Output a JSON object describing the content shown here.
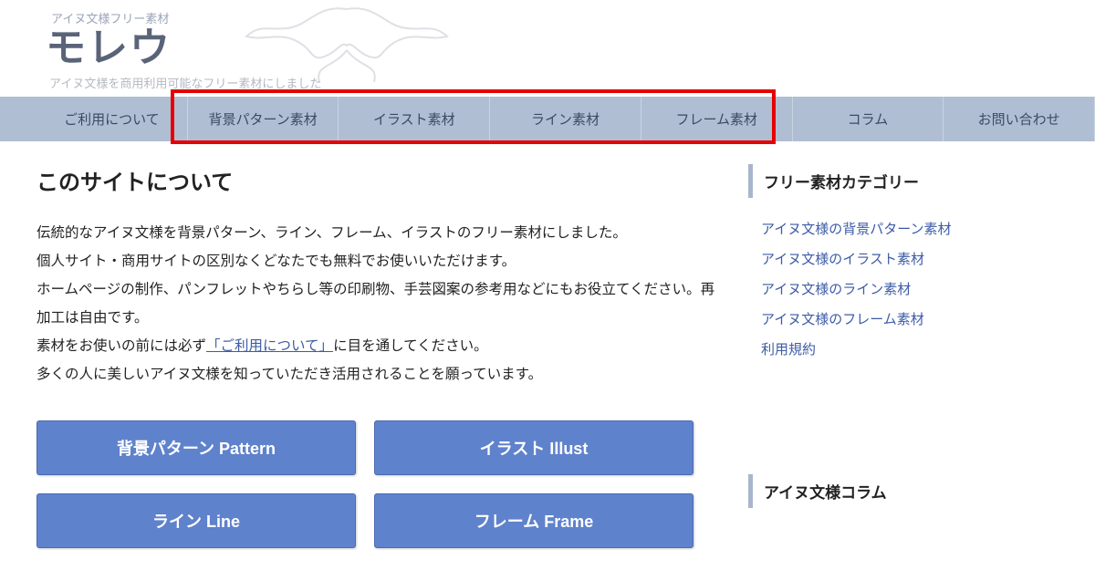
{
  "header": {
    "subtitle": "アイヌ文様フリー素材",
    "logo": "モレウ",
    "tagline": "アイヌ文様を商用利用可能なフリー素材にしました"
  },
  "nav": [
    "ご利用について",
    "背景パターン素材",
    "イラスト素材",
    "ライン素材",
    "フレーム素材",
    "コラム",
    "お問い合わせ"
  ],
  "main": {
    "title": "このサイトについて",
    "p1": "伝統的なアイヌ文様を背景パターン、ライン、フレーム、イラストのフリー素材にしました。",
    "p2": "個人サイト・商用サイトの区別なくどなたでも無料でお使いいただけます。",
    "p3": "ホームページの制作、パンフレットやちらし等の印刷物、手芸図案の参考用などにもお役立てください。再加工は自由です。",
    "p4a": "素材をお使いの前には必ず",
    "p4_link": "「ご利用について」",
    "p4b": "に目を通してください。",
    "p5": "多くの人に美しいアイヌ文様を知っていただき活用されることを願っています。"
  },
  "buttons": {
    "pattern": "背景パターン Pattern",
    "illust": "イラスト Illust",
    "line": "ライン Line",
    "frame": "フレーム Frame"
  },
  "sidebar": {
    "cat_heading": "フリー素材カテゴリー",
    "links": [
      "アイヌ文様の背景パターン素材",
      "アイヌ文様のイラスト素材",
      "アイヌ文様のライン素材",
      "アイヌ文様のフレーム素材",
      "利用規約"
    ],
    "column_heading": "アイヌ文様コラム"
  }
}
